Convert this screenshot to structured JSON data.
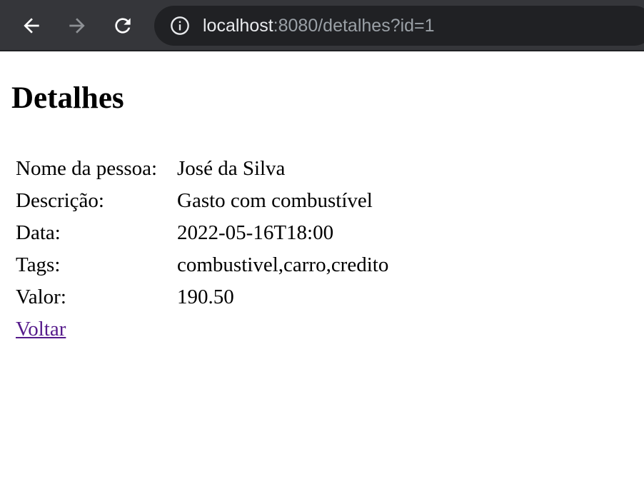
{
  "browser": {
    "url_host": "localhost",
    "url_rest": ":8080/detalhes?id=1",
    "back_icon": "back-arrow-icon",
    "forward_icon": "forward-arrow-icon",
    "reload_icon": "reload-icon",
    "info_icon": "info-icon"
  },
  "page": {
    "title": "Detalhes",
    "rows": [
      {
        "label": "Nome da pessoa:",
        "value": "José da Silva"
      },
      {
        "label": "Descrição:",
        "value": "Gasto com combustível"
      },
      {
        "label": "Data:",
        "value": "2022-05-16T18:00"
      },
      {
        "label": "Tags:",
        "value": "combustivel,carro,credito"
      },
      {
        "label": "Valor:",
        "value": "190.50"
      }
    ],
    "back_link": "Voltar"
  },
  "colors": {
    "toolbar_bg": "#35363a",
    "omnibox_bg": "#202124",
    "visited_link": "#551a8b"
  }
}
